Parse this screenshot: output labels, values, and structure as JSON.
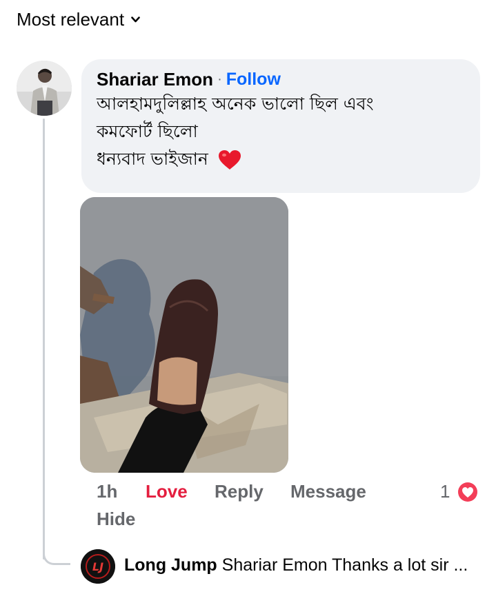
{
  "sort": {
    "label": "Most relevant"
  },
  "comment": {
    "author": "Shariar Emon",
    "separator": "·",
    "follow_label": "Follow",
    "lines": [
      "আলহামদুলিল্লাহ অনেক ভালো ছিল এবং",
      "কমফোর্ট ছিলো",
      "ধন্যবাদ ভাইজান"
    ],
    "has_photo": true
  },
  "actions": {
    "time": "1h",
    "love": "Love",
    "reply": "Reply",
    "message": "Message",
    "reaction_count": "1",
    "hide": "Hide"
  },
  "reply": {
    "author": "Long Jump",
    "text": "Shariar Emon Thanks a lot sir ...",
    "avatar_text": "LJ"
  },
  "colors": {
    "link": "#0866ff",
    "love": "#e41e3f",
    "muted": "#65676b",
    "bubble": "#f0f2f5"
  }
}
